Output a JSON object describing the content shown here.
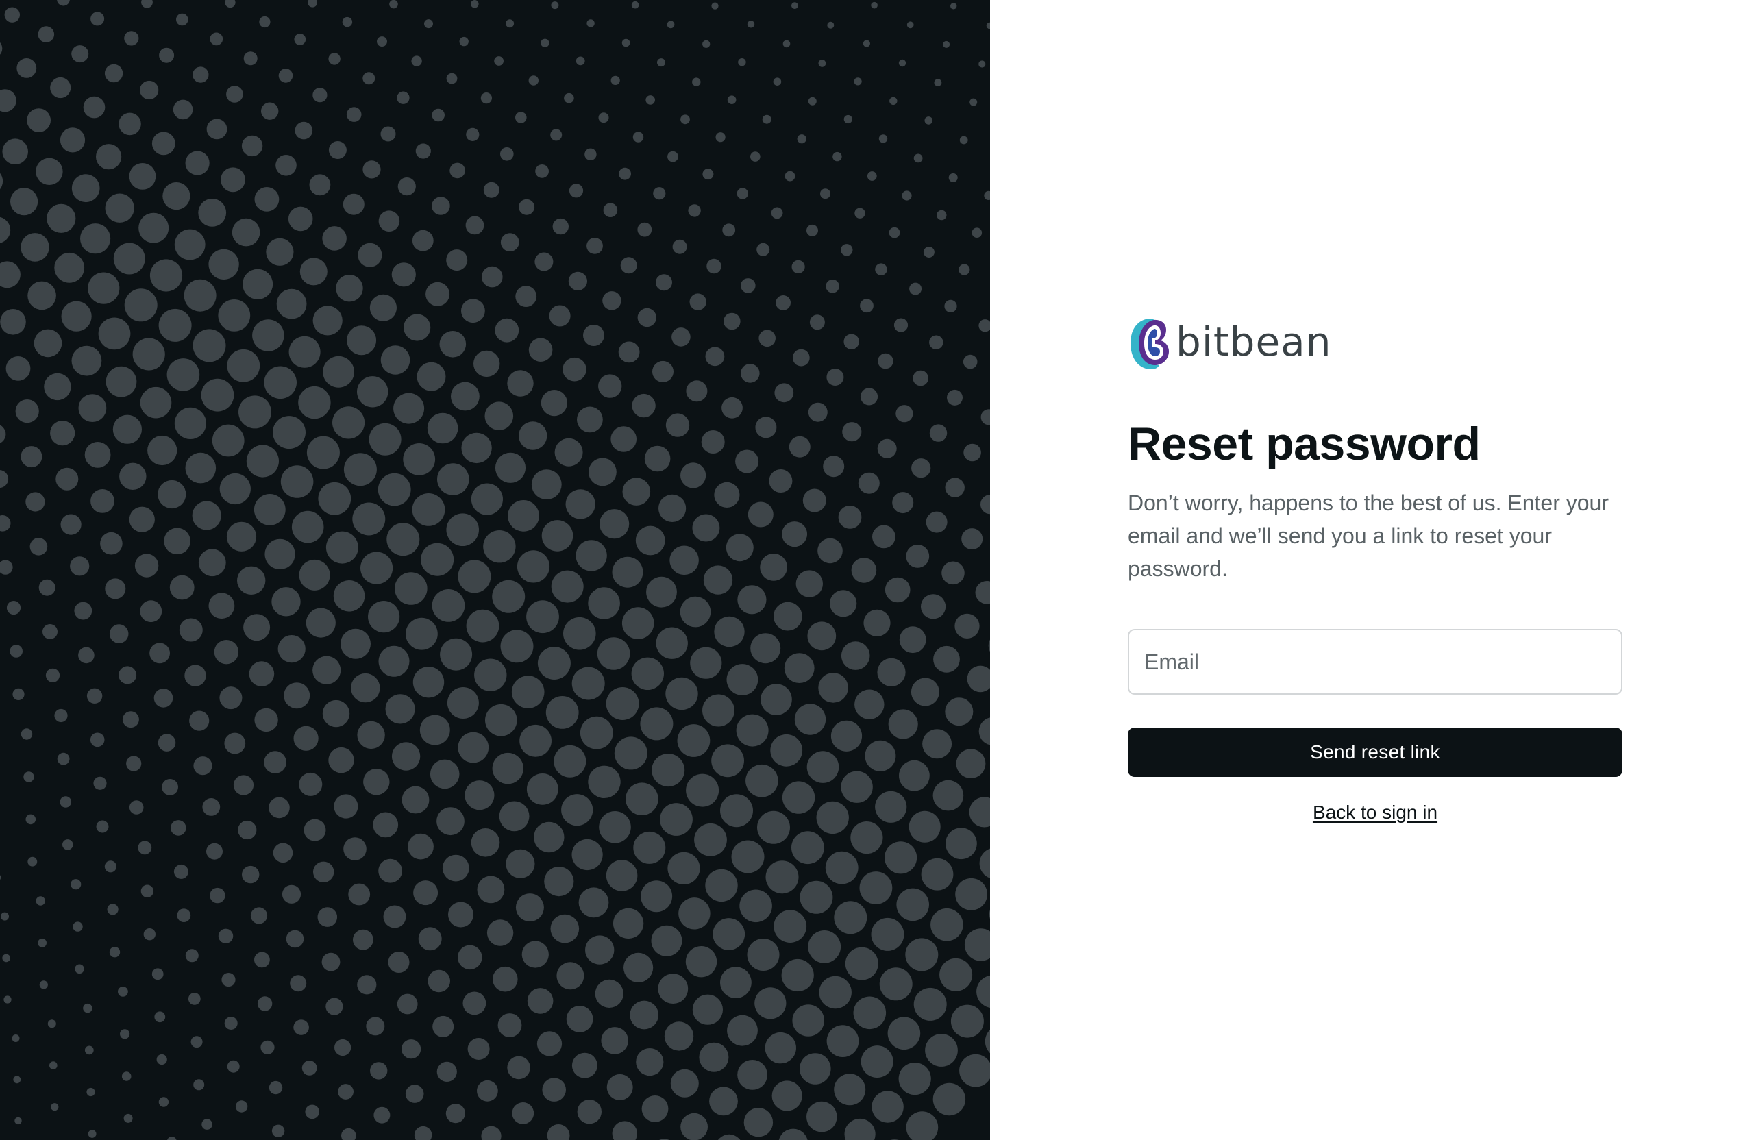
{
  "brand": {
    "name": "bitbean",
    "logo_icon": "bitbean-logo-icon"
  },
  "reset": {
    "title": "Reset password",
    "subtitle": "Don’t worry, happens to the best of us. Enter your email and we’ll send you a link to reset your password.",
    "email_placeholder": "Email",
    "email_value": "",
    "submit_label": "Send reset link",
    "back_link_label": "Back to sign in"
  },
  "theme": {
    "art_background": "#0c1215",
    "dot_color": "#3e4549",
    "button_color": "#0c1215",
    "logo_teal": "#35b3c9",
    "logo_purple": "#5a2f8f",
    "logo_blue": "#2e4fa8"
  }
}
